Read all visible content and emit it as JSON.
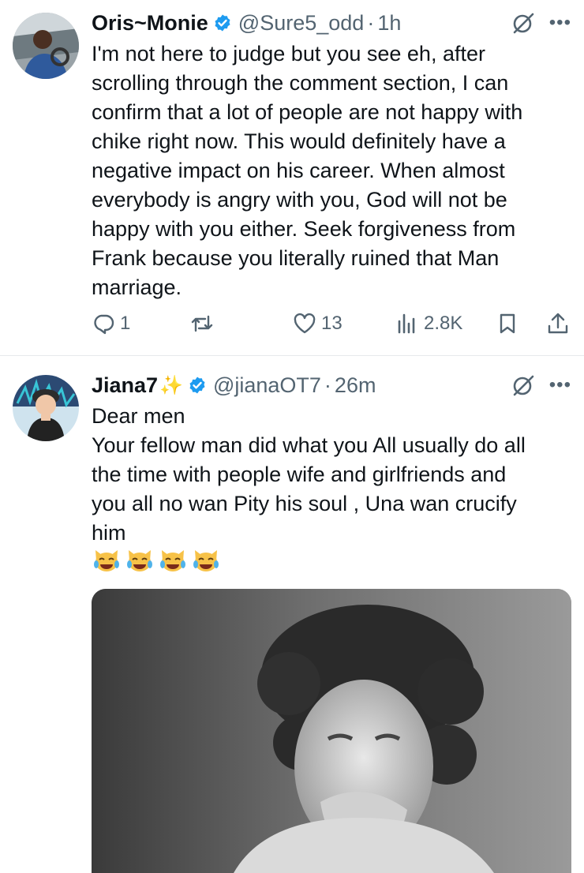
{
  "tweets": [
    {
      "display_name": "Oris~Monie",
      "handle": "@Sure5_odd",
      "separator": "·",
      "time": "1h",
      "avatar_icon": "avatar-photo",
      "verified_color": "#1d9bf0",
      "text_lines": [
        "I'm not here to judge but you see eh,  after",
        "scrolling through the comment section, I can",
        "confirm that a lot of people are not happy with",
        "chike right now. This would definitely have a",
        "negative impact on his career. When almost",
        "everybody is angry with you, God will not be",
        "happy with you either. Seek forgiveness from",
        "Frank because you literally ruined that Man",
        "marriage."
      ],
      "actions": {
        "reply_count": "1",
        "retweet_count": "",
        "like_count": "13",
        "views_count": "2.8K"
      }
    },
    {
      "display_name": "Jiana7",
      "name_emoji": "✨",
      "handle": "@jianaOT7",
      "separator": "·",
      "time": "26m",
      "avatar_icon": "avatar-cartoon",
      "verified_color": "#1d9bf0",
      "text_lines": [
        "Dear men",
        "Your fellow man did what you All usually do  all",
        "the time  with people wife and girlfriends and",
        "you all no wan Pity his soul , Una wan crucify",
        "him"
      ],
      "emoji_icons": [
        "joy-cat-emoji",
        "joy-cat-emoji",
        "joy-cat-emoji",
        "joy-cat-emoji"
      ],
      "media_icon": "laughing-child-photo"
    }
  ],
  "colors": {
    "text": "#0f1419",
    "secondary": "#536471",
    "verified": "#1d9bf0",
    "divider": "#e6e9ec"
  }
}
